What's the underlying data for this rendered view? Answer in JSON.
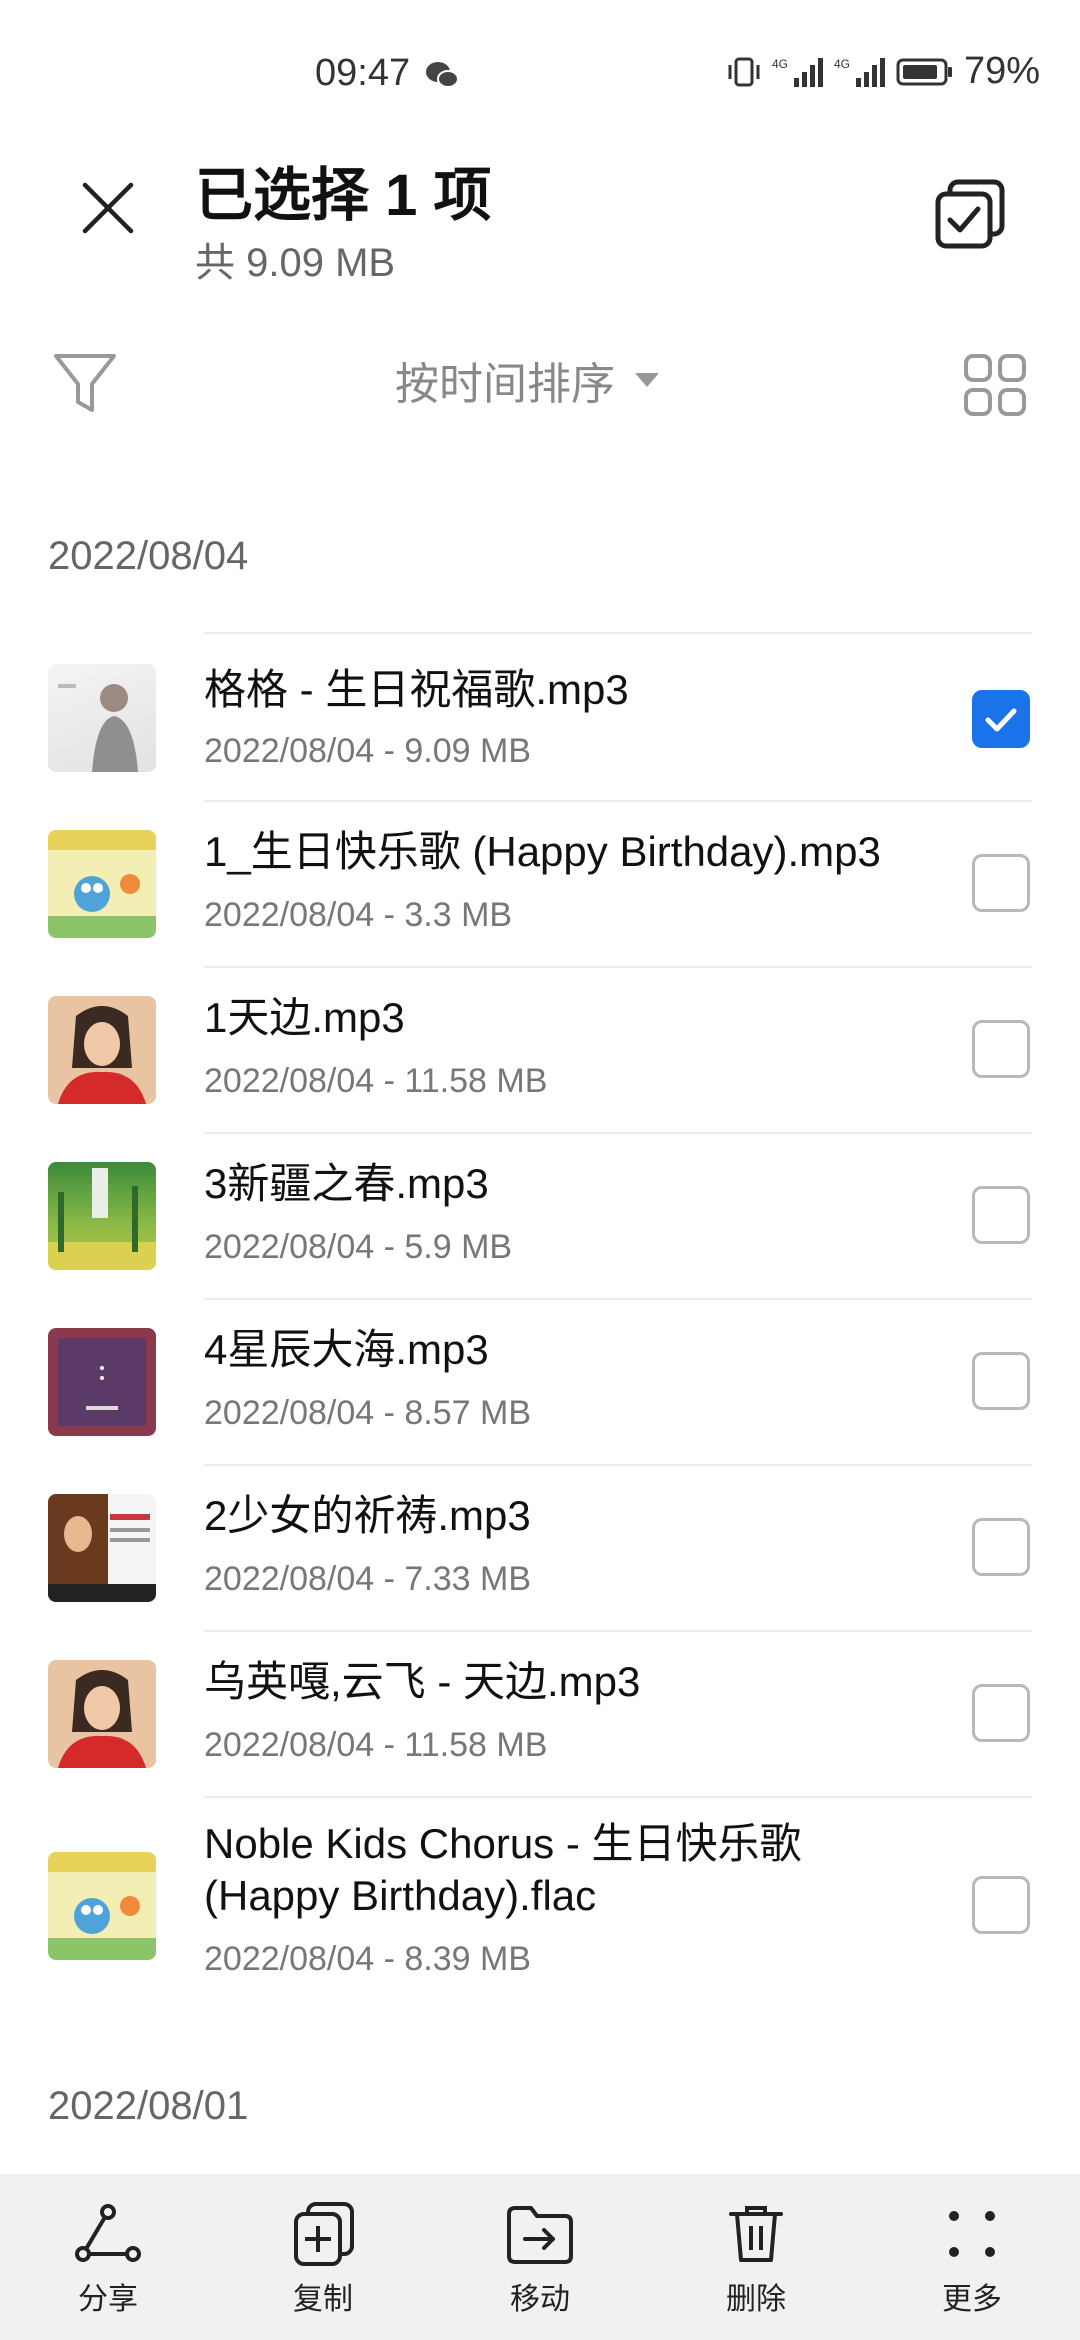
{
  "status_bar": {
    "time": "09:47",
    "battery": "79%",
    "signal1": "4G",
    "signal2": "4G"
  },
  "header": {
    "title": "已选择 1 项",
    "subtitle": "共 9.09 MB"
  },
  "toolbar": {
    "sort_label": "按时间排序"
  },
  "sections": [
    {
      "date": "2022/08/04",
      "files": [
        {
          "name": "格格 - 生日祝福歌.mp3",
          "meta": "2022/08/04 - 9.09 MB",
          "checked": true
        },
        {
          "name": "1_生日快乐歌 (Happy Birthday).mp3",
          "meta": "2022/08/04 - 3.3 MB",
          "checked": false
        },
        {
          "name": "1天边.mp3",
          "meta": "2022/08/04 - 11.58 MB",
          "checked": false
        },
        {
          "name": "3新疆之春.mp3",
          "meta": "2022/08/04 - 5.9 MB",
          "checked": false
        },
        {
          "name": "4星辰大海.mp3",
          "meta": "2022/08/04 - 8.57 MB",
          "checked": false
        },
        {
          "name": "2少女的祈祷.mp3",
          "meta": "2022/08/04 - 7.33 MB",
          "checked": false
        },
        {
          "name": "乌英嘎,云飞 - 天边.mp3",
          "meta": "2022/08/04 - 11.58 MB",
          "checked": false
        },
        {
          "name": "Noble Kids Chorus - 生日快乐歌 (Happy Birthday).flac",
          "meta": "2022/08/04 - 8.39 MB",
          "checked": false
        }
      ]
    },
    {
      "date": "2022/08/01",
      "files": []
    }
  ],
  "bottom_nav": [
    {
      "label": "分享",
      "icon": "share-icon"
    },
    {
      "label": "复制",
      "icon": "copy-icon"
    },
    {
      "label": "移动",
      "icon": "move-icon"
    },
    {
      "label": "删除",
      "icon": "delete-icon"
    },
    {
      "label": "更多",
      "icon": "more-icon"
    }
  ],
  "colors": {
    "accent": "#1a73e8",
    "secondary_text": "#777777",
    "bottom_bar": "#f1f1f1"
  }
}
